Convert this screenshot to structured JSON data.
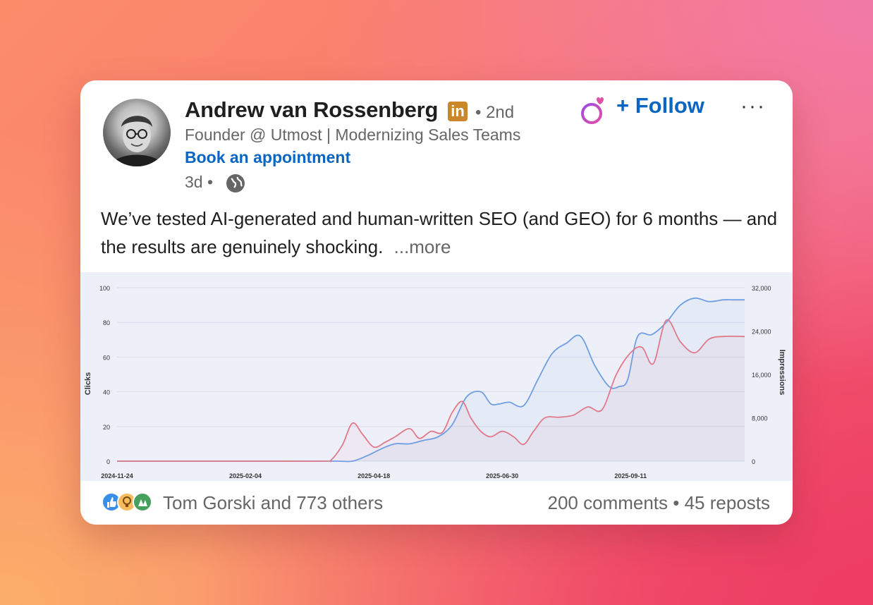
{
  "post": {
    "author_name": "Andrew van Rossenberg",
    "linkedin_badge": "in",
    "degree": "• 2nd",
    "headline": "Founder @ Utmost | Modernizing Sales Teams",
    "book_link": "Book an appointment",
    "age": "3d •",
    "follow_label": "+ Follow",
    "more_menu": "···",
    "text": "We’ve tested AI-generated and human-written SEO (and GEO) for 6 months — and the results are genuinely shocking.",
    "more_label": "...more"
  },
  "reactions": {
    "icons": [
      "like-icon",
      "insightful-icon",
      "celebrate-icon"
    ],
    "names": "Tom Gorski and 773 others",
    "comments": "200 comments",
    "separator": " • ",
    "reposts": "45 reposts"
  },
  "colors": {
    "link": "#0a66c2",
    "clicks_line": "#6f9fe0",
    "impressions_line": "#e07a8a"
  },
  "chart_data": {
    "type": "line",
    "ylabel": "Clicks",
    "y2label": "Impressions",
    "ylim": [
      0,
      100
    ],
    "y2lim": [
      0,
      32000
    ],
    "y_ticks": [
      "0",
      "20",
      "40",
      "60",
      "80",
      "100"
    ],
    "y2_ticks": [
      "0",
      "8,000",
      "16,000",
      "24,000",
      "32,000"
    ],
    "x_ticks": [
      "2024-11-24",
      "2025-02-04",
      "2025-04-18",
      "2025-06-30",
      "2025-09-11"
    ],
    "grid": true,
    "series": [
      {
        "axis": "left",
        "color": "#6f9fe0",
        "x": [
          0,
          50,
          100,
          145,
          155,
          165,
          175,
          185,
          195,
          205,
          215,
          225,
          235,
          245,
          255,
          262,
          268,
          275,
          285,
          295,
          305,
          315,
          325,
          335,
          345,
          352,
          358,
          365,
          375,
          385,
          395,
          405,
          415,
          425,
          432,
          440
        ],
        "values": [
          0,
          0,
          0,
          0,
          0,
          0,
          3,
          7,
          10,
          10,
          12,
          14,
          21,
          37,
          40,
          33,
          33,
          34,
          32,
          47,
          62,
          68,
          72,
          55,
          43,
          43,
          47,
          72,
          73,
          80,
          90,
          94,
          92,
          93,
          93,
          93
        ]
      },
      {
        "axis": "right",
        "color": "#e07a8a",
        "x": [
          0,
          50,
          100,
          145,
          150,
          158,
          165,
          172,
          180,
          188,
          195,
          205,
          212,
          220,
          228,
          235,
          242,
          248,
          255,
          262,
          270,
          278,
          285,
          292,
          300,
          310,
          320,
          330,
          340,
          350,
          360,
          368,
          376,
          385,
          395,
          405,
          415,
          425,
          440
        ],
        "values": [
          0,
          0,
          0,
          0,
          200,
          3000,
          7000,
          5000,
          2600,
          3500,
          4500,
          6000,
          4200,
          5500,
          5300,
          9000,
          11000,
          8000,
          5500,
          4500,
          5500,
          4500,
          3100,
          5500,
          8000,
          8100,
          8500,
          10000,
          9500,
          16000,
          20000,
          21000,
          18000,
          26000,
          22000,
          20000,
          22500,
          23000,
          23000
        ]
      }
    ]
  }
}
